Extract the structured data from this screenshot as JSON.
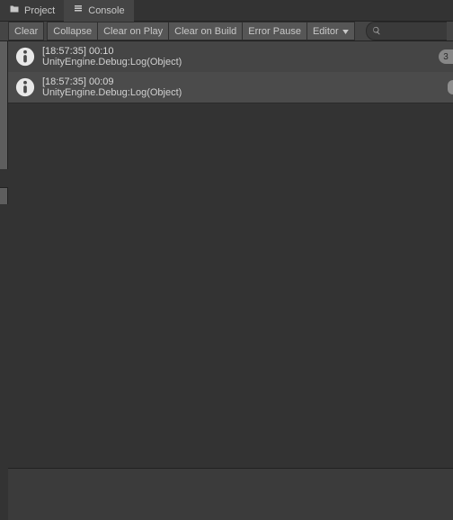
{
  "tabs": {
    "project": "Project",
    "console": "Console"
  },
  "toolbar": {
    "clear": "Clear",
    "collapse": "Collapse",
    "clear_on_play": "Clear on Play",
    "clear_on_build": "Clear on Build",
    "error_pause": "Error Pause",
    "editor": "Editor"
  },
  "search": {
    "placeholder": ""
  },
  "logs": [
    {
      "timestamp": "[18:57:35]",
      "message": "00:10",
      "stack": "UnityEngine.Debug:Log(Object)",
      "count": "3"
    },
    {
      "timestamp": "[18:57:35]",
      "message": "00:09",
      "stack": "UnityEngine.Debug:Log(Object)",
      "count": null
    }
  ]
}
